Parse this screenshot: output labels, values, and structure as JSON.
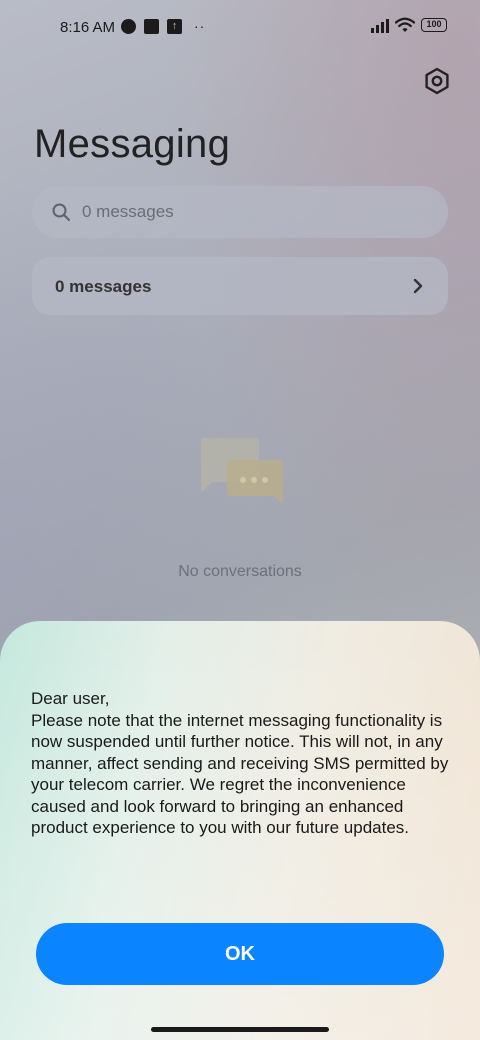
{
  "status_bar": {
    "time": "8:16 AM",
    "notification_icons": [
      "app-circle-icon",
      "square-icon",
      "upload-icon"
    ],
    "more": "··",
    "battery": "100"
  },
  "header": {
    "title": "Messaging",
    "settings_icon": "settings-icon"
  },
  "search": {
    "placeholder": "0 messages"
  },
  "messages_row": {
    "label": "0 messages"
  },
  "empty_state": {
    "text": "No conversations"
  },
  "dialog": {
    "greeting": "Dear user,",
    "body": "Please note that the internet messaging functionality is now suspended until further notice. This will not, in any manner, affect sending and receiving SMS permitted by your telecom carrier. We regret the inconvenience caused and look forward to bringing an enhanced product experience to you with our future updates.",
    "ok_label": "OK",
    "accent_color": "#0a84ff"
  }
}
